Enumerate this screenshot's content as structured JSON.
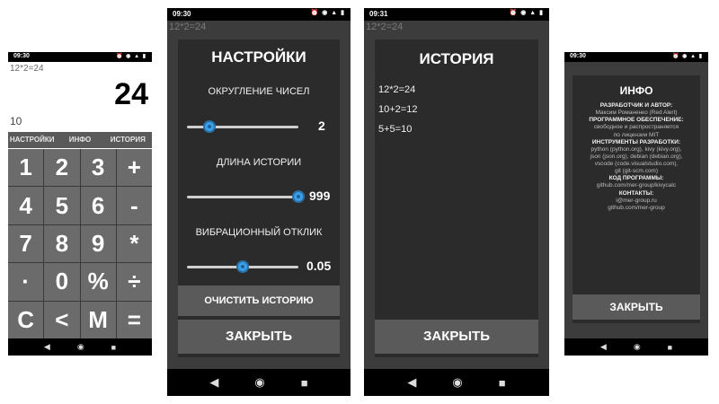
{
  "status": {
    "screen1_time": "09:30",
    "screen2_time": "09:30",
    "screen3_time": "09:31",
    "screen4_time": "09:30",
    "icons_text": "⏰ ◉ ▲ ▮"
  },
  "calculator": {
    "expression": "12*2=24",
    "result": "24",
    "memory": "10",
    "menu": [
      "НАСТРОЙКИ",
      "ИНФО",
      "ИСТОРИЯ"
    ],
    "keys": [
      "1",
      "2",
      "3",
      "+",
      "4",
      "5",
      "6",
      "-",
      "7",
      "8",
      "9",
      "*",
      "·",
      "0",
      "%",
      "÷",
      "C",
      "<",
      "M",
      "="
    ]
  },
  "settings": {
    "title": "НАСТРОЙКИ",
    "rounding_label": "ОКРУГЛЕНИЕ ЧИСЕЛ",
    "rounding_value": "2",
    "rounding_level": 0.2,
    "history_label": "ДЛИНА ИСТОРИИ",
    "history_value": "999",
    "history_level": 1.0,
    "vibration_label": "ВИБРАЦИОННЫЙ ОТКЛИК",
    "vibration_value": "0.05",
    "vibration_level": 0.5,
    "clear_button": "ОЧИСТИТЬ ИСТОРИЮ",
    "close_button": "ЗАКРЫТЬ"
  },
  "history": {
    "title": "ИСТОРИЯ",
    "items": [
      "12*2=24",
      "10+2=12",
      "5+5=10"
    ],
    "close_button": "ЗАКРЫТЬ"
  },
  "info": {
    "title": "ИНФО",
    "author_head": "РАЗРАБОТЧИК И АВТОР:",
    "author": "Максим Романенко (Red Alert)",
    "software_head": "ПРОГРАММНОЕ ОБЕСПЕЧЕНИЕ:",
    "software_1": "свободное и распространяется",
    "software_2": "по лицензии MIT",
    "tools_head": "ИНСТРУМЕНТЫ РАЗРАБОТКИ:",
    "tools_1": "python (python.org), kivy (kivy.org),",
    "tools_2": "json (json.org), debian (debian.org),",
    "tools_3": "vscode (code.visualstudio.com),",
    "tools_4": "git (git-scm.com)",
    "code_head": "КОД ПРОГРАММЫ:",
    "code": "github.com/mer-group/kivycalc",
    "contacts_head": "КОНТАКТЫ:",
    "contact_1": "i@mer-group.ru",
    "contact_2": "github.com/mer-group",
    "close_button": "ЗАКРЫТЬ"
  },
  "colors": {
    "accent": "#3aa0e8",
    "key_bg": "#6b6b6b",
    "dialog_bg": "#2b2b2b",
    "button_bg": "#5a5a5a"
  }
}
